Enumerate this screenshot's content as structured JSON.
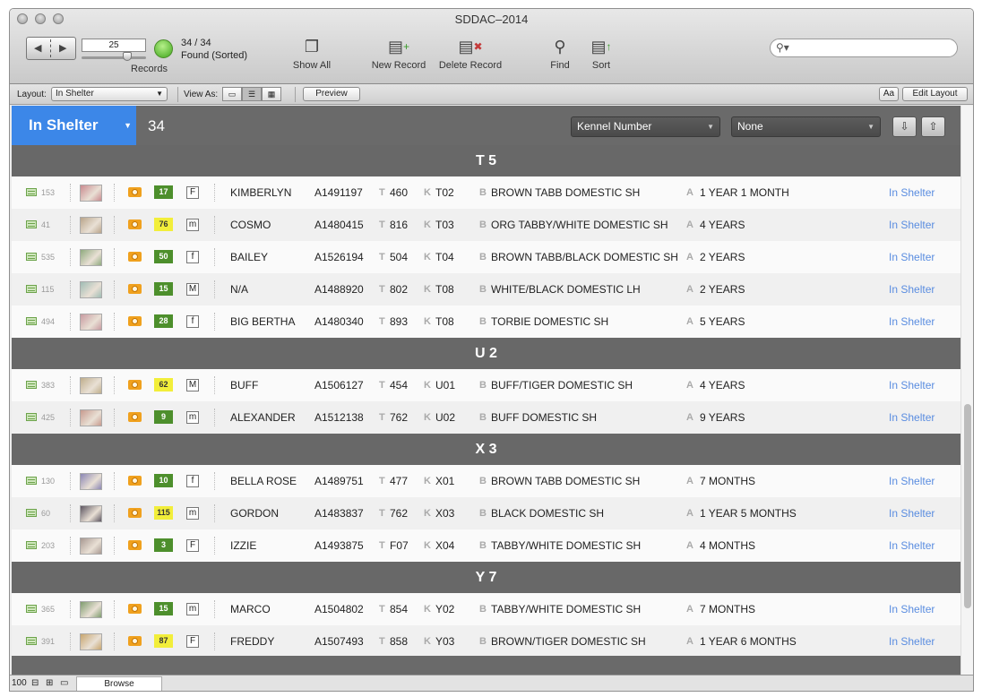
{
  "window": {
    "title": "SDDAC–2014"
  },
  "toolbar": {
    "record_field": "25",
    "records_label": "Records",
    "found_count": "34 / 34",
    "found_status": "Found (Sorted)",
    "show_all": "Show All",
    "new_record": "New Record",
    "delete_record": "Delete Record",
    "find": "Find",
    "sort": "Sort",
    "search_placeholder": ""
  },
  "layoutbar": {
    "layout_label": "Layout:",
    "layout_value": "In Shelter",
    "view_as_label": "View As:",
    "preview": "Preview",
    "aa": "Aa",
    "edit_layout": "Edit Layout"
  },
  "header": {
    "layout_name": "In Shelter",
    "count": "34",
    "sort_field": "Kennel Number",
    "sort_second": "None"
  },
  "labels": {
    "t": "T",
    "k": "K",
    "b": "B",
    "a": "A"
  },
  "groups": [
    {
      "title": "T 5",
      "rows": [
        {
          "id": "153",
          "days": "17",
          "days_color": "green",
          "sex": "F",
          "name": "KIMBERLYN",
          "animal_id": "A1491197",
          "t": "460",
          "kennel": "T02",
          "breed": "BROWN TABB DOMESTIC SH",
          "age": "1 YEAR 1 MONTH",
          "status": "In Shelter"
        },
        {
          "id": "41",
          "days": "76",
          "days_color": "yellow",
          "sex": "m",
          "name": "COSMO",
          "animal_id": "A1480415",
          "t": "816",
          "kennel": "T03",
          "breed": "ORG TABBY/WHITE DOMESTIC SH",
          "age": "4 YEARS",
          "status": "In Shelter"
        },
        {
          "id": "535",
          "days": "50",
          "days_color": "green",
          "sex": "f",
          "name": "BAILEY",
          "animal_id": "A1526194",
          "t": "504",
          "kennel": "T04",
          "breed": "BROWN TABB/BLACK DOMESTIC SH",
          "age": "2 YEARS",
          "status": "In Shelter"
        },
        {
          "id": "115",
          "days": "15",
          "days_color": "green",
          "sex": "M",
          "name": "N/A",
          "animal_id": "A1488920",
          "t": "802",
          "kennel": "T08",
          "breed": "WHITE/BLACK DOMESTIC LH",
          "age": "2 YEARS",
          "status": "In Shelter"
        },
        {
          "id": "494",
          "days": "28",
          "days_color": "green",
          "sex": "f",
          "name": "BIG BERTHA",
          "animal_id": "A1480340",
          "t": "893",
          "kennel": "T08",
          "breed": "TORBIE DOMESTIC SH",
          "age": "5 YEARS",
          "status": "In Shelter"
        }
      ]
    },
    {
      "title": "U 2",
      "rows": [
        {
          "id": "383",
          "days": "62",
          "days_color": "yellow",
          "sex": "M",
          "name": "BUFF",
          "animal_id": "A1506127",
          "t": "454",
          "kennel": "U01",
          "breed": "BUFF/TIGER DOMESTIC SH",
          "age": "4 YEARS",
          "status": "In Shelter"
        },
        {
          "id": "425",
          "days": "9",
          "days_color": "green",
          "sex": "m",
          "name": "ALEXANDER",
          "animal_id": "A1512138",
          "t": "762",
          "kennel": "U02",
          "breed": "BUFF DOMESTIC SH",
          "age": "9 YEARS",
          "status": "In Shelter"
        }
      ]
    },
    {
      "title": "X 3",
      "rows": [
        {
          "id": "130",
          "days": "10",
          "days_color": "green",
          "sex": "f",
          "name": "BELLA ROSE",
          "animal_id": "A1489751",
          "t": "477",
          "kennel": "X01",
          "breed": "BROWN TABB DOMESTIC SH",
          "age": "7 MONTHS",
          "status": "In Shelter"
        },
        {
          "id": "60",
          "days": "115",
          "days_color": "yellow",
          "sex": "m",
          "name": "GORDON",
          "animal_id": "A1483837",
          "t": "762",
          "kennel": "X03",
          "breed": "BLACK DOMESTIC SH",
          "age": "1 YEAR 5 MONTHS",
          "status": "In Shelter"
        },
        {
          "id": "203",
          "days": "3",
          "days_color": "green",
          "sex": "F",
          "name": "IZZIE",
          "animal_id": "A1493875",
          "t": "F07",
          "kennel": "X04",
          "breed": "TABBY/WHITE DOMESTIC SH",
          "age": "4 MONTHS",
          "status": "In Shelter"
        }
      ]
    },
    {
      "title": "Y 7",
      "rows": [
        {
          "id": "365",
          "days": "15",
          "days_color": "green",
          "sex": "m",
          "name": "MARCO",
          "animal_id": "A1504802",
          "t": "854",
          "kennel": "Y02",
          "breed": "TABBY/WHITE DOMESTIC SH",
          "age": "7 MONTHS",
          "status": "In Shelter"
        },
        {
          "id": "391",
          "days": "87",
          "days_color": "yellow",
          "sex": "F",
          "name": "FREDDY",
          "animal_id": "A1507493",
          "t": "858",
          "kennel": "Y03",
          "breed": "BROWN/TIGER DOMESTIC SH",
          "age": "1 YEAR 6 MONTHS",
          "status": "In Shelter"
        }
      ]
    }
  ],
  "photo_colors": [
    "#c98a8f",
    "#b9a48a",
    "#8faa7e",
    "#9fbcb4",
    "#c79aa0",
    "#bfae8c",
    "#c79a8e",
    "#8a86b4",
    "#5c5560",
    "#a79891",
    "#7e9c6e",
    "#c7a56e"
  ],
  "statusbar": {
    "zoom": "100",
    "mode": "Browse"
  },
  "colors": {
    "accent_blue": "#3c87e8",
    "badge_green": "#4d8f2c",
    "badge_yellow": "#f2ee3a",
    "status_link": "#5a8de0"
  }
}
